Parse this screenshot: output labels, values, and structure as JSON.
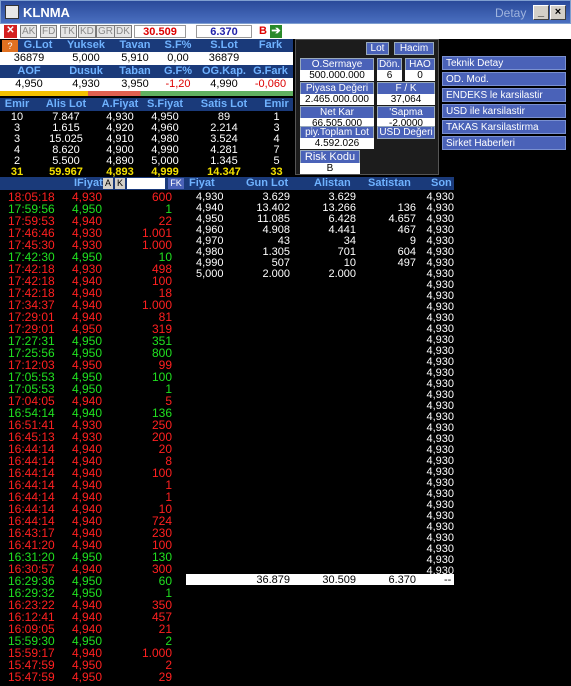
{
  "window": {
    "title": "KLNMA",
    "detay": "Detay"
  },
  "toolbar": {
    "buttons": [
      "AK",
      "FD",
      "TK",
      "KD",
      "GR",
      "DK"
    ],
    "price_sell": "30.509",
    "price_buy": "6.370",
    "b": "B"
  },
  "summary": {
    "headers1": [
      "G.Lot",
      "Yuksek",
      "Tavan",
      "S.F%",
      "S.Lot",
      "Fark"
    ],
    "values1": [
      "36879",
      "5,000",
      "5,910",
      "0,00",
      "36879",
      ""
    ],
    "headers2": [
      "AOF",
      "Dusuk",
      "Taban",
      "G.F%",
      "OG.Kap.",
      "G.Fark"
    ],
    "values2": [
      "4,950",
      "4,930",
      "3,950",
      "-1,20",
      "4,990",
      "-0,060"
    ]
  },
  "depth": {
    "headers": [
      "Emir",
      "Alis Lot",
      "A.Fiyat",
      "S.Fiyat",
      "Satis Lot",
      "Emir"
    ],
    "rows": [
      [
        "10",
        "7.847",
        "4,930",
        "4,950",
        "89",
        "1"
      ],
      [
        "3",
        "1.615",
        "4,920",
        "4,960",
        "2.214",
        "3"
      ],
      [
        "3",
        "15.025",
        "4,910",
        "4,980",
        "3.524",
        "4"
      ],
      [
        "4",
        "8.620",
        "4,900",
        "4,990",
        "4.281",
        "7"
      ],
      [
        "2",
        "5.500",
        "4,890",
        "5,000",
        "1.345",
        "5"
      ]
    ],
    "total": [
      "31",
      "59.967",
      "4,893",
      "4,999",
      "14.347",
      "33"
    ]
  },
  "panel": {
    "lot": "Lot",
    "hacim": "Hacim",
    "o_sermaye": "O.Sermaye",
    "o_sermaye_v": "500.000.000",
    "don": "Dön.",
    "don_v": "6",
    "hao": "HAO",
    "hao_v": "0",
    "piyasa": "Piyasa Değeri",
    "piyasa_v": "2.465.000.000",
    "fk": "F / K",
    "fk_v": "37,064",
    "netkar": "Net Kar",
    "netkar_v": "66.505.000",
    "sapma": "'Sapma",
    "sapma_v": "-2.0000",
    "piy_toplam": "piy.Toplam Lot",
    "piy_toplam_v": "4.592.026",
    "usd": "USD Değeri",
    "risk": "Risk Kodu",
    "risk_v": "B"
  },
  "links": [
    "Teknik Detay",
    "OD. Mod.",
    "ENDEKS le karsilastir",
    "USD ile karsilastir",
    "TAKAS Karsilastirma",
    "Sirket Haberleri"
  ],
  "tape": {
    "header": "IFiyat",
    "btn_a": "A",
    "btn_k": "K",
    "btn_fk": "FK",
    "rows": [
      [
        "18:05:18",
        "4,930",
        "600",
        "r"
      ],
      [
        "17:59:56",
        "4,950",
        "1",
        "g"
      ],
      [
        "17:59:53",
        "4,940",
        "22",
        "r"
      ],
      [
        "17:46:46",
        "4,930",
        "1.001",
        "r"
      ],
      [
        "17:45:30",
        "4,930",
        "1.000",
        "r"
      ],
      [
        "17:42:30",
        "4,950",
        "10",
        "g"
      ],
      [
        "17:42:18",
        "4,930",
        "498",
        "r"
      ],
      [
        "17:42:18",
        "4,940",
        "100",
        "r"
      ],
      [
        "17:42:18",
        "4,940",
        "18",
        "r"
      ],
      [
        "17:34:37",
        "4,940",
        "1.000",
        "r"
      ],
      [
        "17:29:01",
        "4,940",
        "81",
        "r"
      ],
      [
        "17:29:01",
        "4,950",
        "319",
        "r"
      ],
      [
        "17:27:31",
        "4,950",
        "351",
        "g"
      ],
      [
        "17:25:56",
        "4,950",
        "800",
        "g"
      ],
      [
        "17:12:03",
        "4,950",
        "99",
        "r"
      ],
      [
        "17:05:53",
        "4,950",
        "100",
        "g"
      ],
      [
        "17:05:53",
        "4,950",
        "1",
        "g"
      ],
      [
        "17:04:05",
        "4,940",
        "5",
        "r"
      ],
      [
        "16:54:14",
        "4,940",
        "136",
        "g"
      ],
      [
        "16:51:41",
        "4,930",
        "250",
        "r"
      ],
      [
        "16:45:13",
        "4,930",
        "200",
        "r"
      ],
      [
        "16:44:14",
        "4,940",
        "20",
        "r"
      ],
      [
        "16:44:14",
        "4,940",
        "8",
        "r"
      ],
      [
        "16:44:14",
        "4,940",
        "100",
        "r"
      ],
      [
        "16:44:14",
        "4,940",
        "1",
        "r"
      ],
      [
        "16:44:14",
        "4,940",
        "1",
        "r"
      ],
      [
        "16:44:14",
        "4,940",
        "10",
        "r"
      ],
      [
        "16:44:14",
        "4,940",
        "724",
        "r"
      ],
      [
        "16:43:17",
        "4,940",
        "230",
        "r"
      ],
      [
        "16:41:20",
        "4,940",
        "100",
        "r"
      ],
      [
        "16:31:20",
        "4,950",
        "130",
        "g"
      ],
      [
        "16:30:57",
        "4,940",
        "300",
        "r"
      ],
      [
        "16:29:36",
        "4,950",
        "60",
        "g"
      ],
      [
        "16:29:32",
        "4,950",
        "1",
        "g"
      ],
      [
        "16:23:22",
        "4,940",
        "350",
        "r"
      ],
      [
        "16:12:41",
        "4,940",
        "457",
        "r"
      ],
      [
        "16:09:05",
        "4,940",
        "21",
        "r"
      ],
      [
        "15:59:30",
        "4,950",
        "2",
        "g"
      ],
      [
        "15:59:17",
        "4,940",
        "1.000",
        "r"
      ],
      [
        "15:47:59",
        "4,950",
        "2",
        "r"
      ],
      [
        "15:47:59",
        "4,950",
        "29",
        "r"
      ]
    ]
  },
  "fy": {
    "headers": [
      "Fiyat",
      "Gun Lot",
      "Alistan",
      "Satistan",
      "Son"
    ],
    "rows": [
      [
        "4,930",
        "3.629",
        "3.629",
        ""
      ],
      [
        "4,940",
        "13.402",
        "13.266",
        "136"
      ],
      [
        "4,950",
        "11.085",
        "6.428",
        "4.657"
      ],
      [
        "4,960",
        "4.908",
        "4.441",
        "467"
      ],
      [
        "4,970",
        "43",
        "34",
        "9"
      ],
      [
        "4,980",
        "1.305",
        "701",
        "604"
      ],
      [
        "4,990",
        "507",
        "10",
        "497"
      ],
      [
        "5,000",
        "2.000",
        "2.000",
        ""
      ]
    ],
    "totals": [
      "36.879",
      "30.509",
      "6.370",
      "--"
    ],
    "son": "4,930"
  }
}
